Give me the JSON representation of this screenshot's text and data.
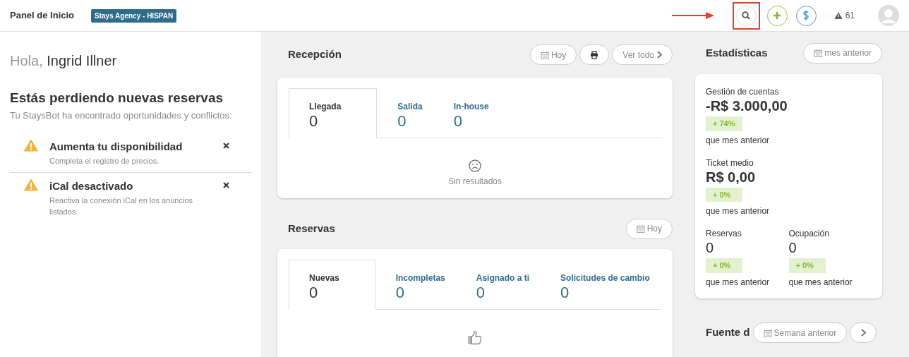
{
  "header": {
    "title": "Panel de Inicio",
    "agency_badge": "Stays Agency - HISPAN",
    "search_highlighted": true,
    "alerts_count": "61"
  },
  "greeting": {
    "prefix": "Hola,",
    "name": "Ingrid Illner"
  },
  "opportunities": {
    "title": "Estás perdiendo nuevas reservas",
    "subtitle": "Tu StaysBot ha encontrado oportunidades y conflictos:",
    "items": [
      {
        "title": "Aumenta tu disponibilidad",
        "description": "Completa el registro de precios."
      },
      {
        "title": "iCal desactivado",
        "description": "Reactiva la conexión iCal en los anuncios listados."
      }
    ]
  },
  "reception": {
    "title": "Recepción",
    "buttons": [
      {
        "kind": "date",
        "label": "Hoy"
      },
      {
        "kind": "print"
      },
      {
        "kind": "more",
        "label": "Ver todo"
      }
    ],
    "tabs": [
      {
        "label": "Llegada",
        "count": "0",
        "selected": true
      },
      {
        "label": "Salida",
        "count": "0",
        "selected": false
      },
      {
        "label": "In-house",
        "count": "0",
        "selected": false
      }
    ],
    "empty": {
      "kind": "sad",
      "text": "Sin resultados"
    }
  },
  "bookings": {
    "title": "Reservas",
    "buttons": [
      {
        "kind": "date",
        "label": "Hoy"
      }
    ],
    "tabs": [
      {
        "label": "Nuevas",
        "count": "0",
        "selected": true
      },
      {
        "label": "Incompletas",
        "count": "0",
        "selected": false
      },
      {
        "label": "Asignado a ti",
        "count": "0",
        "selected": false
      },
      {
        "label": "Solicitudes de cambio",
        "count": "0",
        "selected": false
      }
    ],
    "empty": {
      "kind": "thumbs"
    }
  },
  "stats": {
    "title": "Estadísticas",
    "period": "mes anterior",
    "rows": [
      [
        {
          "label": "Gestión de cuentas",
          "value": "-R$ 3.000,00",
          "change": "+ 74%",
          "compare": "que mes anterior"
        }
      ],
      [
        {
          "label": "Ticket medio",
          "value": "R$ 0,00",
          "change": "+ 0%",
          "compare": "que mes anterior"
        }
      ],
      [
        {
          "label": "Reservas",
          "value": "0",
          "change": "+ 0%",
          "compare": "que mes anterior"
        },
        {
          "label": "Ocupación",
          "value": "0",
          "change": "+ 0%",
          "compare": "que mes anterior"
        }
      ]
    ]
  },
  "sources": {
    "title": "Fuente d",
    "period": "Semana anterior"
  }
}
